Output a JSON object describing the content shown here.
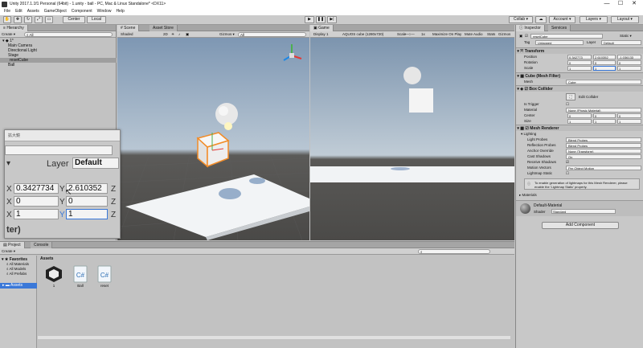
{
  "window": {
    "title": "Unity 2017.1.1f1 Personal (64bit) - 1.unity - ball - PC, Mac & Linux Standalone* <DX11>",
    "minimize": "—",
    "maximize": "☐",
    "close": "✕"
  },
  "menu": [
    "File",
    "Edit",
    "Assets",
    "GameObject",
    "Component",
    "Window",
    "Help"
  ],
  "toolbar": {
    "pivot": "Center",
    "space": "Local",
    "collab": "Collab ▾",
    "account": "Account ▾",
    "layers": "Layers ▾",
    "layout": "Layout ▾"
  },
  "hierarchy": {
    "tab": "Hierarchy",
    "create": "Create ▾",
    "search_placeholder": "All",
    "scene": "1*",
    "items": [
      "Main Camera",
      "Directional Light",
      "Stage",
      "resetCube",
      "Ball"
    ],
    "selected_index": 3
  },
  "scene": {
    "tab": "Scene",
    "tab2": "Asset Store",
    "shading": "Shaded",
    "mode": "2D",
    "gizmos": "Gizmos ▾",
    "search": "All"
  },
  "game": {
    "tab": "Game",
    "display": "Display 1",
    "aspect": "AQUOS cube (1280x720)",
    "scale_label": "Scale",
    "scale_value": "1x",
    "maximize": "Maximize On Play",
    "mute": "Mute Audio",
    "stats": "Stats",
    "gizmos": "Gizmos ▾"
  },
  "inspector": {
    "tab": "Inspector",
    "tab2": "Services",
    "object_name": "resetCube",
    "static": "Static ▾",
    "tag_label": "Tag",
    "tag": "Untagged",
    "layer_label": "Layer",
    "layer": "Default",
    "transform": {
      "title": "Transform",
      "position_label": "Position",
      "rotation_label": "Rotation",
      "scale_label": "Scale",
      "position": [
        "0.342773",
        "2.610352",
        "-1.036133"
      ],
      "rotation": [
        "0",
        "0",
        "0"
      ],
      "scale": [
        "1",
        "1",
        "1"
      ]
    },
    "mesh_filter": {
      "title": "Cube (Mesh Filter)",
      "mesh_label": "Mesh",
      "mesh": "Cube"
    },
    "box_collider": {
      "title": "Box Collider",
      "edit": "Edit Collider",
      "is_trigger": "Is Trigger",
      "material_label": "Material",
      "material": "None (Physic Material)",
      "center_label": "Center",
      "center": [
        "0",
        "0",
        "0"
      ],
      "size_label": "Size",
      "size": [
        "1",
        "1",
        "1"
      ]
    },
    "mesh_renderer": {
      "title": "Mesh Renderer",
      "lighting": "Lighting",
      "rows": [
        {
          "label": "Light Probes",
          "value": "Blend Probes"
        },
        {
          "label": "Reflection Probes",
          "value": "Blend Probes"
        },
        {
          "label": "Anchor Override",
          "value": "None (Transform)"
        },
        {
          "label": "Cast Shadows",
          "value": "On"
        },
        {
          "label": "Receive Shadows",
          "value": ""
        },
        {
          "label": "Motion Vectors",
          "value": "Per Object Motion"
        },
        {
          "label": "Lightmap Static",
          "value": ""
        }
      ],
      "info": "To enable generation of lightmaps for this Mesh Renderer, please enable the 'Lightmap Static' property."
    },
    "materials_label": "Materials",
    "material_name": "Default-Material",
    "shader_label": "Shader",
    "shader": "Standard",
    "add_component": "Add Component"
  },
  "project": {
    "tab": "Project",
    "tab2": "Console",
    "create": "Create ▾",
    "favorites": "Favorites",
    "fav_items": [
      "All Materials",
      "All Models",
      "All Prefabs"
    ],
    "assets_root": "Assets",
    "breadcrumb": "Assets",
    "assets": [
      {
        "name": "1",
        "icon": "unity-scene-icon"
      },
      {
        "name": "Ball",
        "icon": "csharp-script-icon"
      },
      {
        "name": "reset",
        "icon": "csharp-script-icon"
      }
    ]
  },
  "zoom_overlay": {
    "title": "拡大鏡",
    "layer_label": "Layer",
    "layer_value": "Default",
    "row1": {
      "x_label": "X",
      "x": "0.3427734",
      "y_label": "Y",
      "y": "2.610352",
      "z_label": "Z"
    },
    "row2": {
      "x_label": "X",
      "x": "0",
      "y_label": "Y",
      "y": "0",
      "z_label": "Z"
    },
    "row3": {
      "x_label": "X",
      "x": "1",
      "y_label": "Y",
      "y": "1",
      "z_label": "Z"
    },
    "bottom_text": "ter)"
  }
}
